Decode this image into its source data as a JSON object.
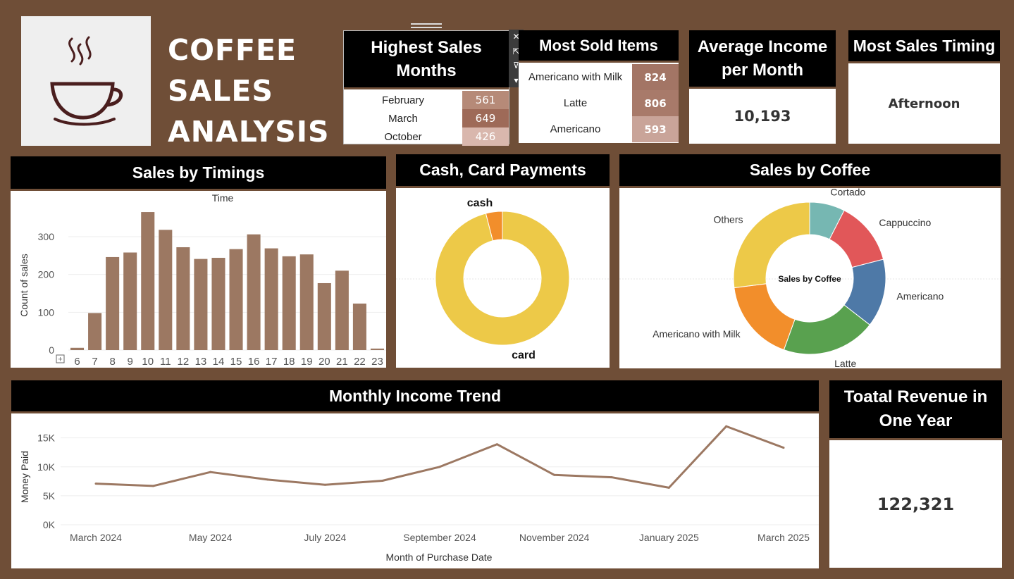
{
  "header": {
    "title_lines": [
      "COFFEE",
      "SALES",
      "ANALYSIS"
    ],
    "logo_icon": "coffee-cup-icon"
  },
  "highest_sales": {
    "title": "Highest Sales Months",
    "rows": [
      {
        "label": "February",
        "value": "561",
        "color": "#b68a78"
      },
      {
        "label": "March",
        "value": "649",
        "color": "#9e6a58"
      },
      {
        "label": "October",
        "value": "426",
        "color": "#d9b7ad"
      }
    ]
  },
  "most_sold": {
    "title": "Most Sold Items",
    "rows": [
      {
        "label": "Americano with Milk",
        "value": "824",
        "color": "#a37565"
      },
      {
        "label": "Latte",
        "value": "806",
        "color": "#a87a6a"
      },
      {
        "label": "Americano",
        "value": "593",
        "color": "#c9a499"
      }
    ]
  },
  "avg_income": {
    "title": "Average Income per Month",
    "value": "10,193"
  },
  "most_sales_timing": {
    "title": "Most Sales Timing",
    "value": "Afternoon"
  },
  "total_revenue": {
    "title": "Toatal Revenue in One Year",
    "value": "122,321"
  },
  "sales_by_timings": {
    "title": "Sales by Timings"
  },
  "payments": {
    "title": "Cash, Card Payments"
  },
  "sales_by_coffee": {
    "title": "Sales by Coffee"
  },
  "monthly_trend": {
    "title": "Monthly Income Trend"
  },
  "chart_data": [
    {
      "type": "bar",
      "title": "Time",
      "ylabel": "Count of sales",
      "categories": [
        "6",
        "7",
        "8",
        "9",
        "10",
        "11",
        "12",
        "13",
        "14",
        "15",
        "16",
        "17",
        "18",
        "19",
        "20",
        "21",
        "22",
        "23"
      ],
      "values": [
        6,
        98,
        246,
        258,
        365,
        318,
        272,
        241,
        244,
        267,
        306,
        269,
        248,
        253,
        177,
        210,
        123,
        4
      ],
      "yticks": [
        0,
        100,
        200,
        300
      ],
      "ylim": [
        0,
        380
      ],
      "color": "#9c7862"
    },
    {
      "type": "pie",
      "labels": [
        "card",
        "cash"
      ],
      "values": [
        96,
        4
      ],
      "colors": [
        "#edc948",
        "#f28e2b"
      ]
    },
    {
      "type": "pie",
      "center_label": "Sales by Coffee",
      "labels": [
        "Cortado",
        "Cappuccino",
        "Americano",
        "Latte",
        "Americano with Milk",
        "Others"
      ],
      "values": [
        7.5,
        13.5,
        14.5,
        20,
        17.5,
        27
      ],
      "colors": [
        "#76b7b2",
        "#e15759",
        "#4e79a7",
        "#59a14f",
        "#f28e2b",
        "#edc948"
      ]
    },
    {
      "type": "line",
      "xlabel": "Month of Purchase Date",
      "ylabel": "Money Paid",
      "x": [
        "March 2024",
        "April 2024",
        "May 2024",
        "June 2024",
        "July 2024",
        "August 2024",
        "September 2024",
        "October 2024",
        "November 2024",
        "December 2024",
        "January 2025",
        "February 2025",
        "March 2025"
      ],
      "xtick_labels": [
        "March 2024",
        "May 2024",
        "July 2024",
        "September 2024",
        "November 2024",
        "January 2025",
        "March 2025"
      ],
      "values": [
        7100,
        6700,
        9100,
        7800,
        6900,
        7600,
        10000,
        13900,
        8600,
        8200,
        6400,
        17000,
        13300
      ],
      "yticks": [
        0,
        5000,
        10000,
        15000
      ],
      "ytick_labels": [
        "0K",
        "5K",
        "10K",
        "15K"
      ],
      "ylim": [
        0,
        18000
      ],
      "color": "#9c7862"
    }
  ]
}
